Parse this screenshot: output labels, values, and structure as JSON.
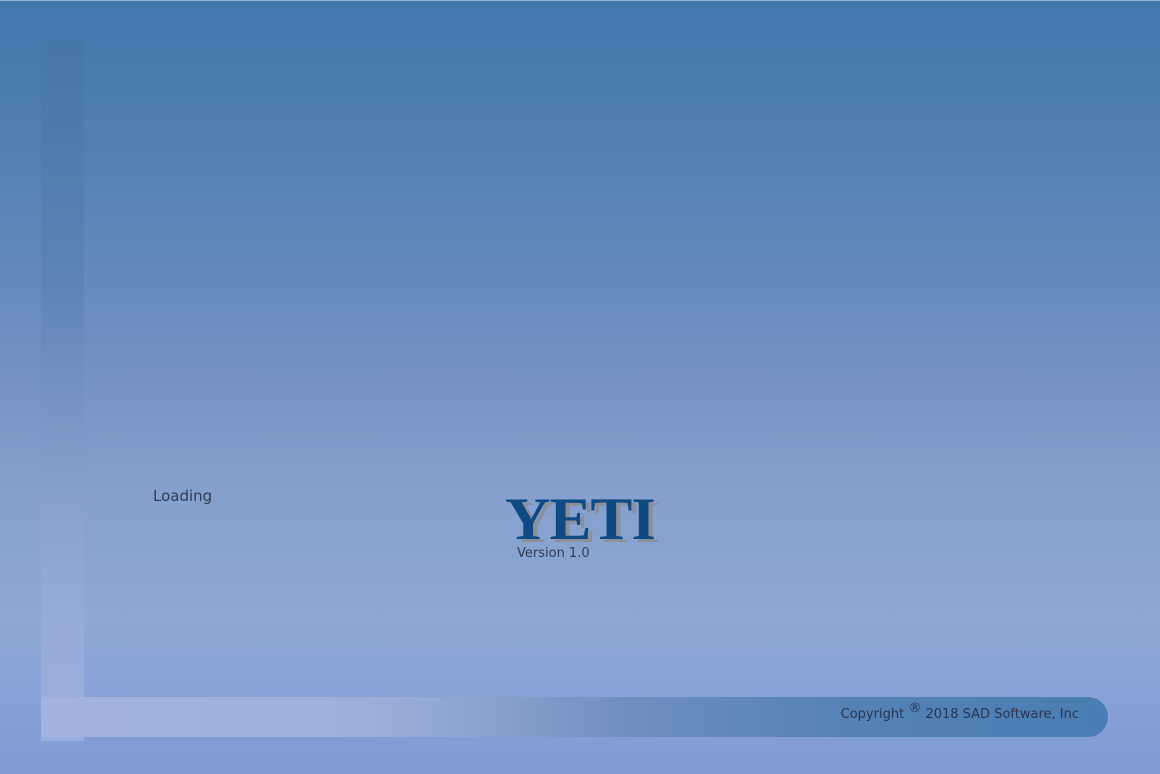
{
  "splash": {
    "status": "Loading",
    "logo_text": "YETI",
    "version": "Version 1.0",
    "copyright_prefix": "Copyright",
    "copyright_symbol": "®",
    "copyright_suffix": "2018 SAD Software, Inc"
  },
  "colors": {
    "logo": "#0f4a82",
    "logo_shadow": "#8a8f99",
    "text": "#2f3b52",
    "background_top": "#4277ab",
    "background_bottom": "#8fa8d6"
  }
}
